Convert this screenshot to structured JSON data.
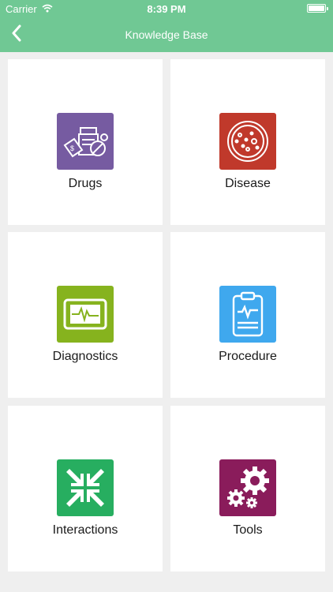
{
  "status_bar": {
    "carrier": "Carrier",
    "time": "8:39 PM"
  },
  "nav": {
    "title": "Knowledge Base",
    "back_icon": "chevron-left-icon"
  },
  "colors": {
    "header": "#70c894",
    "drugs": "#765ba1",
    "disease": "#c0392b",
    "diagnostics": "#86b31e",
    "procedure": "#3fa8ee",
    "interactions": "#27ae60",
    "tools": "#8a1c5b"
  },
  "tiles": [
    {
      "label": "Drugs",
      "icon": "pills-icon"
    },
    {
      "label": "Disease",
      "icon": "petri-dish-icon"
    },
    {
      "label": "Diagnostics",
      "icon": "monitor-icon"
    },
    {
      "label": "Procedure",
      "icon": "clipboard-icon"
    },
    {
      "label": "Interactions",
      "icon": "compress-arrows-icon"
    },
    {
      "label": "Tools",
      "icon": "gears-icon"
    }
  ]
}
